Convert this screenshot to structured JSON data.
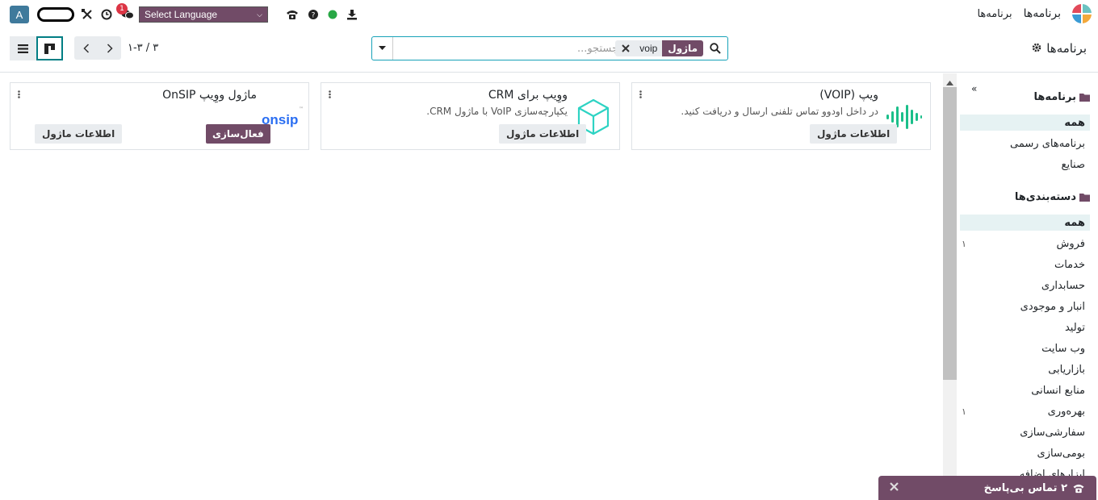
{
  "navbar": {
    "app_title": "برنامه‌ها",
    "menu_apps": "برنامه‌ها",
    "language_select": "Select Language",
    "chat_badge_count": "1",
    "avatar_letter": "A",
    "colors": {
      "brand": "#714b67",
      "avatar": "#3f7a9c",
      "presence": "#28a745"
    }
  },
  "control_panel": {
    "breadcrumb_title": "برنامه‌ها",
    "search": {
      "placeholder": "جستجو...",
      "facet_label": "ماژول",
      "facet_value": "voip"
    },
    "pager": {
      "text": "۱-۳ / ۳"
    }
  },
  "cards": [
    {
      "title": "ویپ (VOIP)",
      "description": "در داخل اودوو تماس تلفنی ارسال و دریافت کنید.",
      "info_label": "اطلاعات ماژول",
      "icon": "soundwave-icon"
    },
    {
      "title": "ووِیپ برای CRM",
      "description": "یکپارچه‌سازی VoIP با ماژول CRM.",
      "info_label": "اطلاعات ماژول",
      "icon": "cube-icon"
    },
    {
      "title": "ماژول ووِیپ OnSIP",
      "description": "",
      "info_label": "اطلاعات ماژول",
      "activate_label": "فعال‌سازی",
      "logo_text": "onsip",
      "logo_tm": "™",
      "icon": "onsip-logo"
    }
  ],
  "sidebar": {
    "apps_header": "برنامه‌ها",
    "apps_items": [
      {
        "label": "همه",
        "active": true
      },
      {
        "label": "برنامه‌های رسمی"
      },
      {
        "label": "صنایع"
      }
    ],
    "categories_header": "دسته‌بندی‌ها",
    "category_items": [
      {
        "label": "همه",
        "active": true,
        "count": ""
      },
      {
        "label": "فروش",
        "count": "۱"
      },
      {
        "label": "خدمات",
        "count": ""
      },
      {
        "label": "حسابداری",
        "count": ""
      },
      {
        "label": "انبار و موجودی",
        "count": ""
      },
      {
        "label": "تولید",
        "count": ""
      },
      {
        "label": "وب سایت",
        "count": ""
      },
      {
        "label": "بازاریابی",
        "count": ""
      },
      {
        "label": "منابع انسانی",
        "count": ""
      },
      {
        "label": "بهره‌وری",
        "count": "۱"
      },
      {
        "label": "سفارشی‌سازی",
        "count": ""
      },
      {
        "label": "بومی‌سازی",
        "count": ""
      },
      {
        "label": "ابزارهای اضافه",
        "count": ""
      }
    ]
  },
  "call_toast": {
    "label": "۲ تماس بی‌پاسخ"
  }
}
